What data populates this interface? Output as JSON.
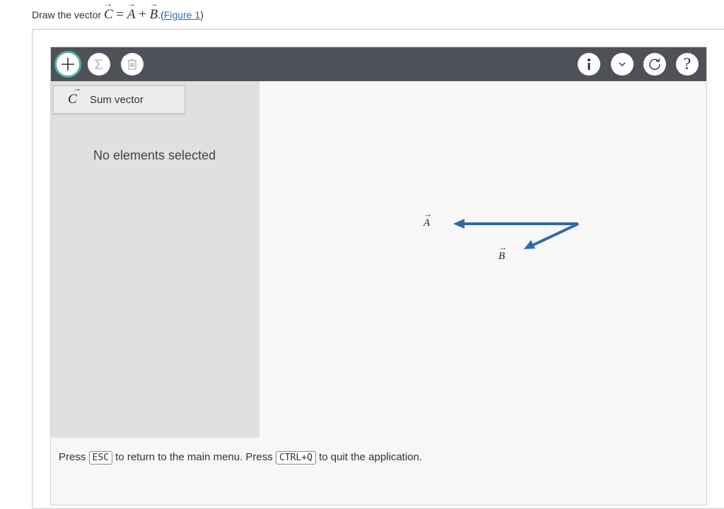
{
  "prompt": {
    "prefix": "Draw the vector ",
    "vec_c": "C",
    "equals": " = ",
    "vec_a": "A",
    "plus": " + ",
    "vec_b": "B",
    "suffix": ".(",
    "link": "Figure 1",
    "close": ")"
  },
  "toolbar": {
    "left_buttons": [
      "plus-icon",
      "sigma-icon",
      "trash-icon"
    ],
    "right_buttons": [
      "info-icon",
      "chevron-down-icon",
      "reset-icon",
      "help-icon"
    ],
    "help_glyph": "?"
  },
  "menu": {
    "symbol": "C",
    "label": "Sum vector"
  },
  "sidebar": {
    "empty_text": "No elements selected"
  },
  "canvas": {
    "label_a": "A",
    "label_b": "B"
  },
  "status": {
    "part1": "Press ",
    "key1": "ESC",
    "part2": " to return to the main menu. Press ",
    "key2": "CTRL+Q",
    "part3": " to quit the application."
  },
  "colors": {
    "toolbar": "#4f5158",
    "accent": "#4fb0ae",
    "vector": "#2f6aad",
    "link": "#2a6ebb"
  }
}
